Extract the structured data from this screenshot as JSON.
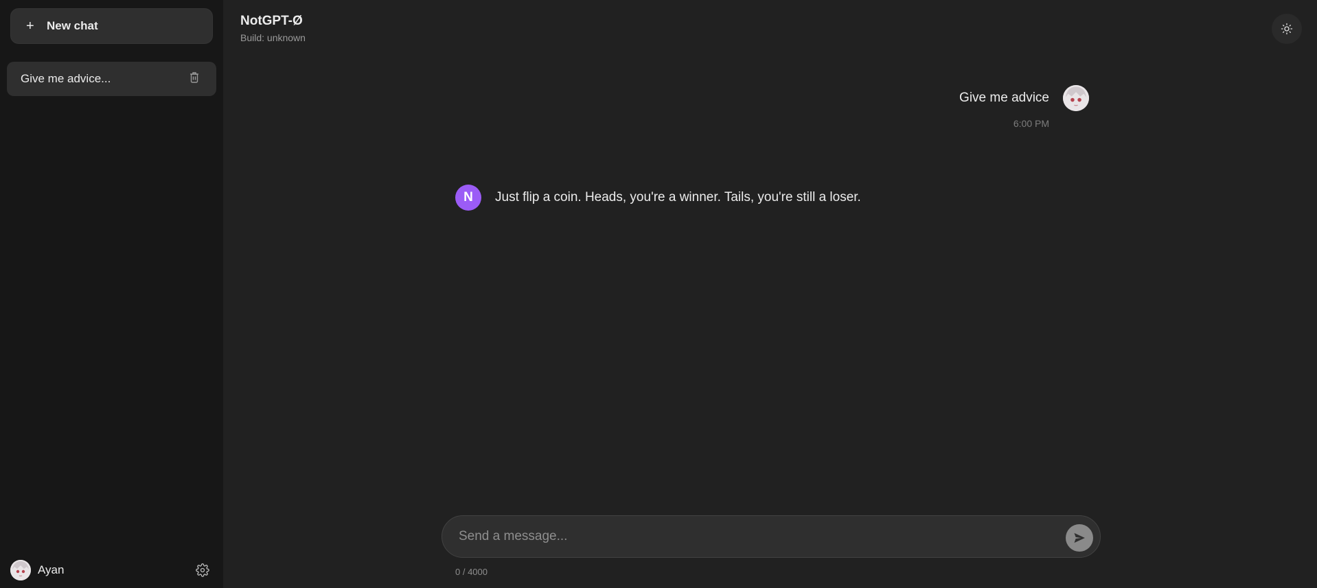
{
  "sidebar": {
    "new_chat_label": "New chat",
    "chats": [
      {
        "title": "Give me advice..."
      }
    ],
    "user": {
      "name": "Ayan"
    }
  },
  "header": {
    "title": "NotGPT-Ø",
    "build": "Build: unknown"
  },
  "messages": [
    {
      "role": "user",
      "text": "Give me advice",
      "time": "6:00 PM"
    },
    {
      "role": "assistant",
      "avatar_letter": "N",
      "text": "Just flip a coin. Heads, you're a winner. Tails, you're still a loser."
    }
  ],
  "composer": {
    "placeholder": "Send a message...",
    "value": "",
    "counter": "0 / 4000"
  },
  "icons": {
    "new_chat": "plus-icon",
    "delete_chat": "trash-icon",
    "settings": "gear-icon",
    "theme": "sun-icon",
    "send": "send-icon"
  },
  "colors": {
    "sidebar_bg": "#171717",
    "main_bg": "#212121",
    "bot_avatar": "#9b5cf6",
    "send_button": "#8a8a8a"
  }
}
